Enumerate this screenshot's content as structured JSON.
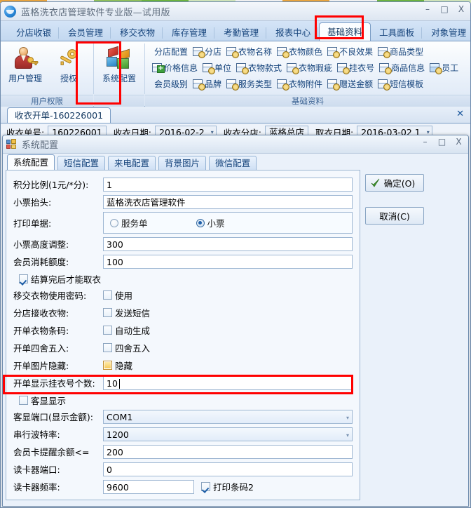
{
  "bg_strip_colors": [
    "#e8a33d",
    "#f0f0f0",
    "#8fbf5a",
    "#6cb33f",
    "#cfe3b8",
    "#f0f0f0",
    "#e8a33d",
    "#f0f0f0",
    "#6cb33f",
    "#cfe3b8"
  ],
  "app": {
    "title": "蓝格洗衣店管理软件专业版—试用版",
    "logo_icon": "app-logo-icon",
    "window_controls": {
      "minimize": "–",
      "maximize": "□",
      "close": "X"
    }
  },
  "ribbon_tabs": [
    {
      "label": "分店收银",
      "active": false
    },
    {
      "label": "会员管理",
      "active": false
    },
    {
      "label": "移交衣物",
      "active": false
    },
    {
      "label": "库存管理",
      "active": false
    },
    {
      "label": "考勤管理",
      "active": false
    },
    {
      "label": "报表中心",
      "active": false
    },
    {
      "label": "基础资料",
      "active": true
    },
    {
      "label": "工具面板",
      "active": false
    },
    {
      "label": "对象管理",
      "active": false
    }
  ],
  "ribbon": {
    "group_user": {
      "caption": "用户权限",
      "buttons": [
        {
          "label": "用户管理",
          "icon": "user-key-icon"
        },
        {
          "label": "授权",
          "icon": "key-icon"
        }
      ]
    },
    "group_config": {
      "caption": "",
      "buttons": [
        {
          "label": "系统配置",
          "icon": "color-cube-icon"
        }
      ]
    },
    "group_basic": {
      "caption": "基础资料",
      "rows": [
        [
          {
            "label": "分店配置",
            "icon": ""
          },
          {
            "label": "分店",
            "icon": "table-gear-icon"
          },
          {
            "label": "衣物名称",
            "icon": "table-gear-icon"
          },
          {
            "label": "衣物颜色",
            "icon": "table-gear-icon"
          },
          {
            "label": "不良效果",
            "icon": "table-gear-icon"
          },
          {
            "label": "商品类型",
            "icon": "table-gear-icon"
          }
        ],
        [
          {
            "label": "价格信息",
            "icon": "table-plus-icon"
          },
          {
            "label": "单位",
            "icon": "table-gear-icon"
          },
          {
            "label": "衣物款式",
            "icon": "table-gear-icon"
          },
          {
            "label": "衣物瑕疵",
            "icon": "table-gear-icon"
          },
          {
            "label": "挂衣号",
            "icon": "table-gear-icon"
          },
          {
            "label": "商品信息",
            "icon": "table-gear-icon"
          },
          {
            "label": "员工",
            "icon": "table-gear-blue-icon"
          }
        ],
        [
          {
            "label": "会员级别",
            "icon": ""
          },
          {
            "label": "品牌",
            "icon": "table-gear-icon"
          },
          {
            "label": "服务类型",
            "icon": "table-gear-icon"
          },
          {
            "label": "衣物附件",
            "icon": "table-gear-icon"
          },
          {
            "label": "赠送金额",
            "icon": "table-gear-icon"
          },
          {
            "label": "短信模板",
            "icon": "table-gear-icon"
          }
        ]
      ]
    }
  },
  "document_tab": {
    "label": "收衣开单-160226001",
    "close_icon": "close-icon"
  },
  "behind_form": [
    {
      "label": "收衣单号:",
      "value": "160226001",
      "type": "text"
    },
    {
      "label": "收衣日期:",
      "value": "2016-02-2",
      "type": "combo"
    },
    {
      "label": "收衣分店:",
      "value": "蓝格总店",
      "type": "text"
    },
    {
      "label": "取衣日期:",
      "value": "2016-03-02 1",
      "type": "combo"
    }
  ],
  "dialog": {
    "title": "系统配置",
    "icon": "window-blocks-icon",
    "window_controls": {
      "minimize": "–",
      "maximize": "□",
      "close": "X"
    },
    "tabs": [
      {
        "label": "系统配置",
        "active": true
      },
      {
        "label": "短信配置",
        "active": false
      },
      {
        "label": "来电配置",
        "active": false
      },
      {
        "label": "背景图片",
        "active": false
      },
      {
        "label": "微信配置",
        "active": false
      }
    ],
    "fields": [
      {
        "kind": "text",
        "label": "积分比例(1元/*分):",
        "value": "1"
      },
      {
        "kind": "text",
        "label": "小票抬头:",
        "value": "蓝格洗衣店管理软件"
      },
      {
        "kind": "radio",
        "label": "打印单据:",
        "options": [
          {
            "label": "服务单",
            "checked": false
          },
          {
            "label": "小票",
            "checked": true
          }
        ]
      },
      {
        "kind": "text",
        "label": "小票高度调整:",
        "value": "300"
      },
      {
        "kind": "text",
        "label": "会员消耗额度:",
        "value": "100"
      },
      {
        "kind": "check_standalone",
        "label": "结算完后才能取衣",
        "checked": true
      },
      {
        "kind": "check",
        "label": "移交衣物使用密码:",
        "cb_label": "使用",
        "checked": false
      },
      {
        "kind": "check",
        "label": "分店接收衣物:",
        "cb_label": "发送短信",
        "checked": false
      },
      {
        "kind": "check",
        "label": "开单衣物条码:",
        "cb_label": "自动生成",
        "checked": false
      },
      {
        "kind": "check",
        "label": "开单四舍五入:",
        "cb_label": "四舍五入",
        "checked": false
      },
      {
        "kind": "check",
        "label": "开单图片隐藏:",
        "cb_label": "隐藏",
        "checked": false,
        "hot": true
      },
      {
        "kind": "text",
        "label": "开单显示挂衣号个数:",
        "value": "10",
        "highlighted": true,
        "caret": true
      },
      {
        "kind": "check_standalone",
        "label": "客显显示",
        "checked": false
      },
      {
        "kind": "combo",
        "label": "客显端口(显示金额):",
        "value": "COM1"
      },
      {
        "kind": "combo",
        "label": "串行波特率:",
        "value": "1200"
      },
      {
        "kind": "text",
        "label": "会员卡提醒余额<=",
        "value": "200"
      },
      {
        "kind": "text",
        "label": "读卡器端口:",
        "value": "0"
      },
      {
        "kind": "text_check",
        "label": "读卡器频率:",
        "value": "9600",
        "cb_label": "打印条码2",
        "checked": true
      }
    ],
    "buttons": [
      {
        "label": "确定(O)",
        "accel": "O",
        "text": "确定(",
        "tail": ")",
        "icon": "green-check-icon"
      },
      {
        "label": "取消(C)",
        "accel": "C",
        "text": "取消(",
        "tail": ")",
        "icon": ""
      }
    ]
  },
  "highlight_color": "#ff0000"
}
